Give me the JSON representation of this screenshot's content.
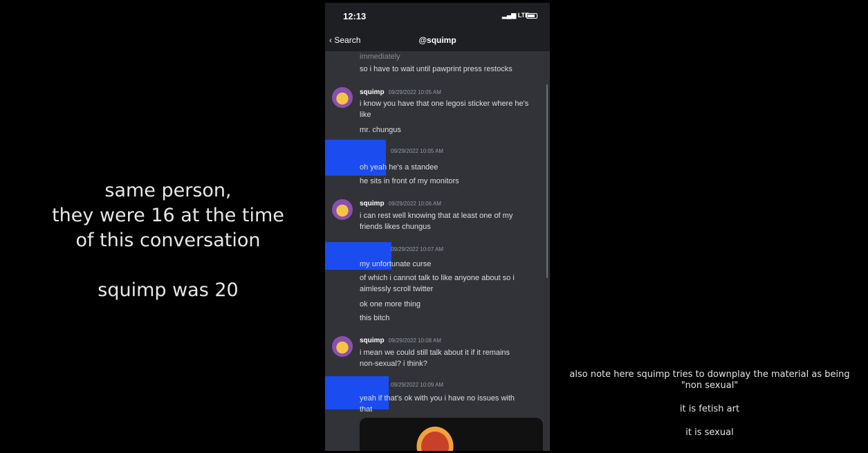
{
  "left_caption": {
    "line1": "same person,",
    "line2": "they were 16 at the time",
    "line3": "of this conversation",
    "line4": "squimp was 20"
  },
  "right_caption": {
    "line1": "also note here squimp tries to downplay the material as being",
    "line2": "\"non sexual\"",
    "line3": "it is fetish art",
    "line4": "it is sexual"
  },
  "phone": {
    "status_time": "12:13",
    "signal": "LTE",
    "back_label": "Search",
    "title": "@squimp",
    "messages": [
      {
        "text": "immediately"
      },
      {
        "text": "so i have to wait until pawprint press restocks"
      },
      {
        "author": "squimp",
        "timestamp": "09/29/2022 10:05 AM",
        "lines": [
          "i know you have that one legosi sticker where he's",
          "like",
          "mr. chungus"
        ]
      },
      {
        "timestamp": "09/29/2022 10:05 AM",
        "lines": [
          "oh yeah he's a standee",
          "he sits in front of my monitors"
        ]
      },
      {
        "author": "squimp",
        "timestamp": "09/29/2022 10:06 AM",
        "lines": [
          "i can rest well knowing that at least one of my",
          "friends likes chungus"
        ]
      },
      {
        "timestamp": "09/29/2022 10:07 AM",
        "lines": [
          "my unfortunate curse",
          "of which i cannot talk to like anyone about so i",
          "aimlessly scroll twitter",
          "ok one more thing",
          "this bitch"
        ]
      },
      {
        "author": "squimp",
        "timestamp": "09/29/2022 10:08 AM",
        "lines": [
          "i mean we could still talk about it if it remains",
          "non-sexual? i think?"
        ]
      },
      {
        "timestamp": "09/29/2022 10:09 AM",
        "lines": [
          "yeah if that's ok with you i have no issues with",
          "that"
        ]
      }
    ]
  }
}
